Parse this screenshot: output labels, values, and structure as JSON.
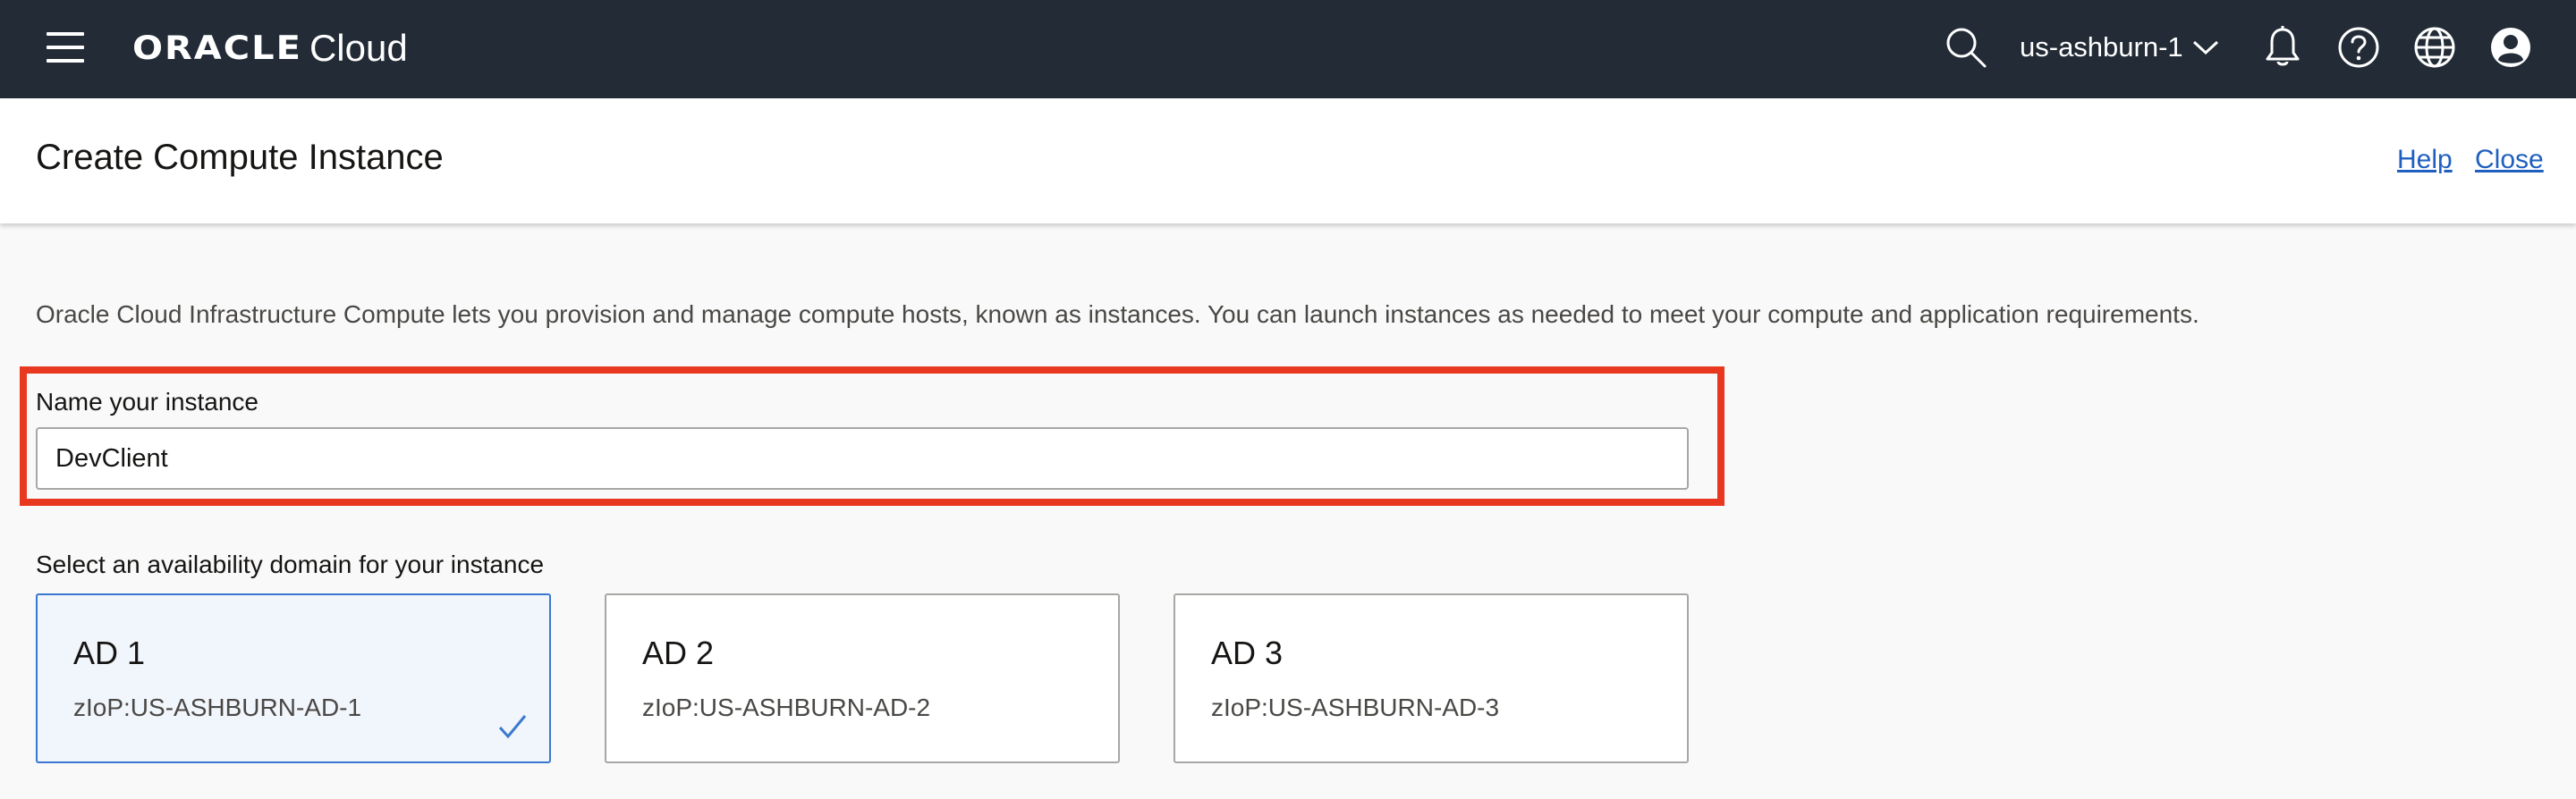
{
  "nav": {
    "brand": "ORACLE",
    "product": "Cloud",
    "region": "us-ashburn-1"
  },
  "header": {
    "title": "Create Compute Instance",
    "help_link": "Help",
    "close_link": "Close"
  },
  "main": {
    "intro": "Oracle Cloud Infrastructure Compute lets you provision and manage compute hosts, known as instances. You can launch instances as needed to meet your compute and application requirements.",
    "name_label": "Name your instance",
    "name_value": "DevClient",
    "ad_label": "Select an availability domain for your instance",
    "availability_domains": [
      {
        "name": "AD 1",
        "code": "zIoP:US-ASHBURN-AD-1",
        "selected": true
      },
      {
        "name": "AD 2",
        "code": "zIoP:US-ASHBURN-AD-2",
        "selected": false
      },
      {
        "name": "AD 3",
        "code": "zIoP:US-ASHBURN-AD-3",
        "selected": false
      }
    ]
  },
  "colors": {
    "topbar": "#222b36",
    "link": "#1f5fbf",
    "highlight": "#e8381f",
    "selected_border": "#3a78d0"
  },
  "icons": [
    "menu-icon",
    "search-icon",
    "chevron-down-icon",
    "bell-icon",
    "help-icon",
    "globe-icon",
    "user-icon",
    "checkmark-icon"
  ]
}
